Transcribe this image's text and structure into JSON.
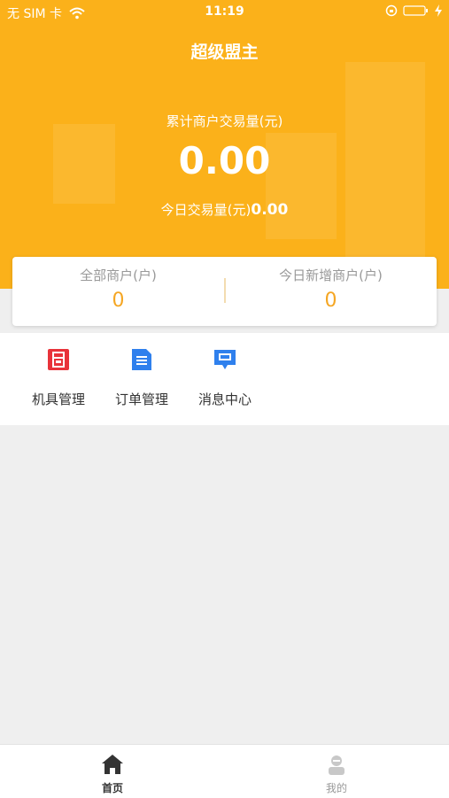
{
  "status_bar": {
    "carrier": "无 SIM 卡",
    "time": "11:19"
  },
  "header": {
    "title": "超级盟主"
  },
  "summary": {
    "cumulative_label": "累计商户交易量(元)",
    "cumulative_value": "0.00",
    "today_label": "今日交易量(元)",
    "today_value": "0.00"
  },
  "stats": {
    "all_merchants_label": "全部商户(户)",
    "all_merchants_value": "0",
    "new_merchants_label": "今日新增商户(户)",
    "new_merchants_value": "0"
  },
  "menu": {
    "items": [
      {
        "label": "机具管理",
        "icon": "device-icon",
        "color": "#e8333a"
      },
      {
        "label": "订单管理",
        "icon": "order-list-icon",
        "color": "#2f80ed"
      },
      {
        "label": "消息中心",
        "icon": "message-icon",
        "color": "#2f80ed"
      }
    ]
  },
  "tabbar": {
    "items": [
      {
        "label": "首页",
        "icon": "home-icon",
        "active": true
      },
      {
        "label": "我的",
        "icon": "user-icon",
        "active": false
      }
    ]
  },
  "colors": {
    "brand": "#fbb11a",
    "stat_value": "#f5a623",
    "background": "#efefef"
  }
}
